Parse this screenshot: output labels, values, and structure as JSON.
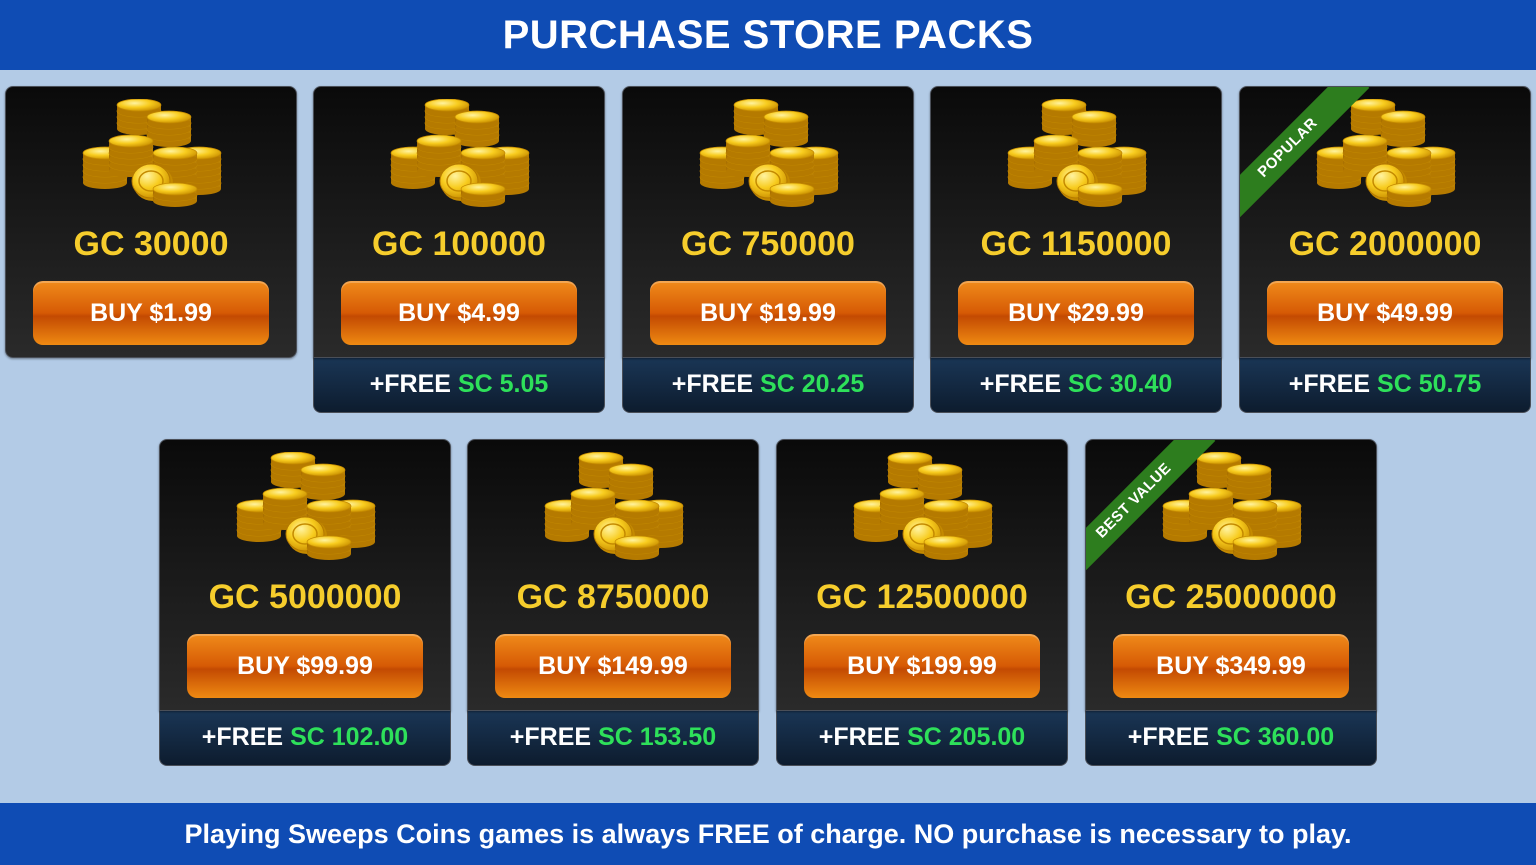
{
  "header": {
    "title": "PURCHASE STORE PACKS"
  },
  "footer": {
    "notice": "Playing Sweeps Coins games is always FREE of charge. NO purchase is necessary to play."
  },
  "colors": {
    "accent_blue": "#0f4cb4",
    "gold": "#f6cd2c",
    "orange": "#e06a0a",
    "green": "#2ee05a",
    "ribbon_green": "#2d7d1e"
  },
  "packs": [
    {
      "amount": "GC 30000",
      "buy_label": "BUY $1.99",
      "bonus_free": "",
      "bonus_sc": "",
      "ribbon": ""
    },
    {
      "amount": "GC 100000",
      "buy_label": "BUY $4.99",
      "bonus_free": "+FREE",
      "bonus_sc": "SC 5.05",
      "ribbon": ""
    },
    {
      "amount": "GC 750000",
      "buy_label": "BUY $19.99",
      "bonus_free": "+FREE",
      "bonus_sc": "SC 20.25",
      "ribbon": ""
    },
    {
      "amount": "GC 1150000",
      "buy_label": "BUY $29.99",
      "bonus_free": "+FREE",
      "bonus_sc": "SC 30.40",
      "ribbon": ""
    },
    {
      "amount": "GC 2000000",
      "buy_label": "BUY $49.99",
      "bonus_free": "+FREE",
      "bonus_sc": "SC 50.75",
      "ribbon": "POPULAR"
    },
    {
      "amount": "GC 5000000",
      "buy_label": "BUY $99.99",
      "bonus_free": "+FREE",
      "bonus_sc": "SC 102.00",
      "ribbon": ""
    },
    {
      "amount": "GC 8750000",
      "buy_label": "BUY $149.99",
      "bonus_free": "+FREE",
      "bonus_sc": "SC 153.50",
      "ribbon": ""
    },
    {
      "amount": "GC 12500000",
      "buy_label": "BUY $199.99",
      "bonus_free": "+FREE",
      "bonus_sc": "SC 205.00",
      "ribbon": ""
    },
    {
      "amount": "GC 25000000",
      "buy_label": "BUY $349.99",
      "bonus_free": "+FREE",
      "bonus_sc": "SC 360.00",
      "ribbon": "BEST VALUE"
    }
  ]
}
